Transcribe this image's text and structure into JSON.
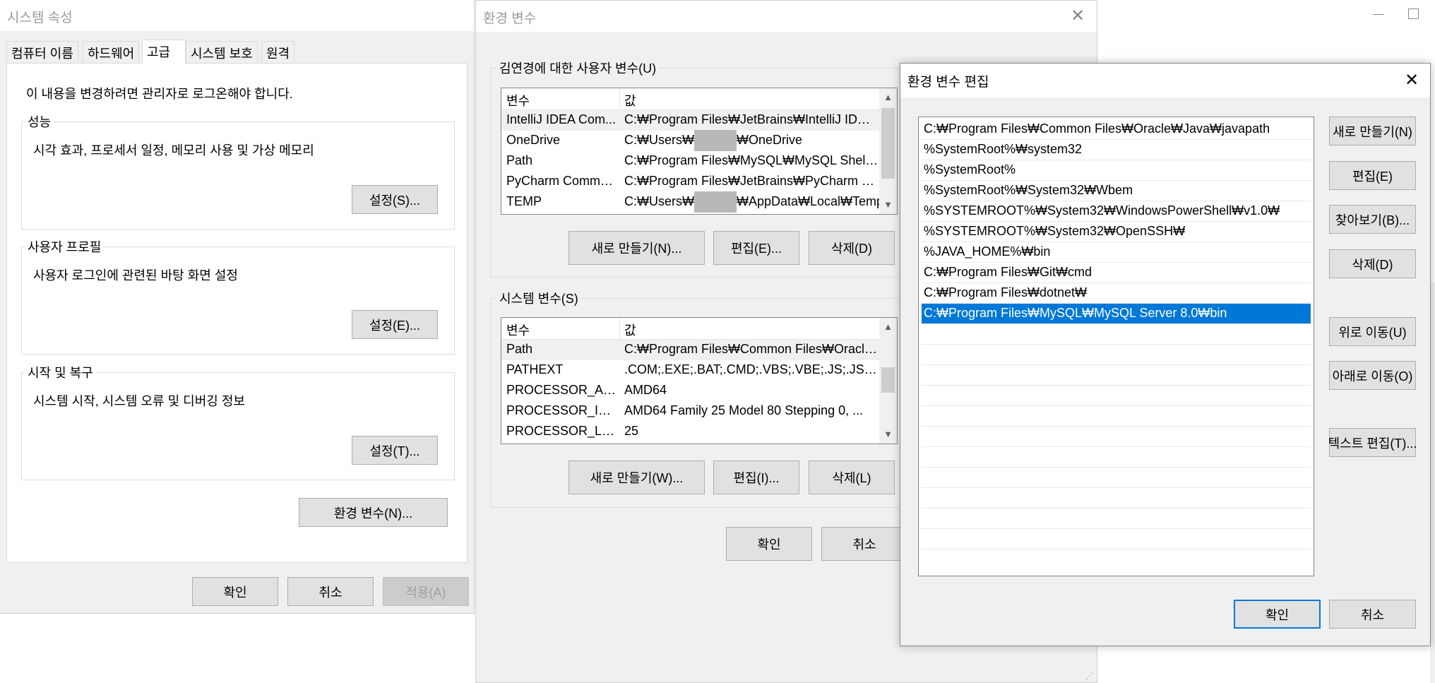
{
  "sys_props": {
    "title": "시스템 속성",
    "tabs": [
      "컴퓨터 이름",
      "하드웨어",
      "고급",
      "시스템 보호",
      "원격"
    ],
    "admin_note": "이 내용을 변경하려면 관리자로 로그온해야 합니다.",
    "perf": {
      "label": "성능",
      "desc": "시각 효과, 프로세서 일정, 메모리 사용 및 가상 메모리",
      "button": "설정(S)..."
    },
    "profile": {
      "label": "사용자 프로필",
      "desc": "사용자 로그인에 관련된 바탕 화면 설정",
      "button": "설정(E)..."
    },
    "startup": {
      "label": "시작 및 복구",
      "desc": "시스템 시작, 시스템 오류 및 디버깅 정보",
      "button": "설정(T)..."
    },
    "env_button": "환경 변수(N)...",
    "ok": "확인",
    "cancel": "취소",
    "apply": "적용(A)"
  },
  "env_vars": {
    "title": "환경 변수",
    "user_group_label": "김연경에 대한 사용자 변수(U)",
    "col_var": "변수",
    "col_val": "값",
    "user_rows": [
      {
        "name": "IntelliJ IDEA Com...",
        "value": "C:₩Program Files₩JetBrains₩IntelliJ IDEA ..."
      },
      {
        "name": "OneDrive",
        "value_pre": "C:₩Users₩",
        "value_post": "₩OneDrive"
      },
      {
        "name": "Path",
        "value": "C:₩Program Files₩MySQL₩MySQL Shell ..."
      },
      {
        "name": "PyCharm Commu...",
        "value": "C:₩Program Files₩JetBrains₩PyCharm Co..."
      },
      {
        "name": "TEMP",
        "value_pre": "C:₩Users₩",
        "value_post": "₩AppData₩Local₩Temp"
      }
    ],
    "user_new": "새로 만들기(N)...",
    "user_edit": "편집(E)...",
    "user_delete": "삭제(D)",
    "sys_group_label": "시스템 변수(S)",
    "sys_rows": [
      {
        "name": "Path",
        "value": "C:₩Program Files₩Common Files₩Oracle..."
      },
      {
        "name": "PATHEXT",
        "value": ".COM;.EXE;.BAT;.CMD;.VBS;.VBE;.JS;.JSE;.W..."
      },
      {
        "name": "PROCESSOR_ARC...",
        "value": "AMD64"
      },
      {
        "name": "PROCESSOR_IDE...",
        "value": "AMD64 Family 25 Model 80 Stepping 0, ..."
      },
      {
        "name": "PROCESSOR_LEVEL",
        "value": "25"
      }
    ],
    "sys_new": "새로 만들기(W)...",
    "sys_edit": "편집(I)...",
    "sys_delete": "삭제(L)",
    "ok": "확인",
    "cancel": "취소"
  },
  "edit_env": {
    "title": "환경 변수 편집",
    "paths": [
      "C:₩Program Files₩Common Files₩Oracle₩Java₩javapath",
      "%SystemRoot%₩system32",
      "%SystemRoot%",
      "%SystemRoot%₩System32₩Wbem",
      "%SYSTEMROOT%₩System32₩WindowsPowerShell₩v1.0₩",
      "%SYSTEMROOT%₩System32₩OpenSSH₩",
      "%JAVA_HOME%₩bin",
      "C:₩Program Files₩Git₩cmd",
      "C:₩Program Files₩dotnet₩",
      "C:₩Program Files₩MySQL₩MySQL Server 8.0₩bin"
    ],
    "selected_index": 9,
    "new": "새로 만들기(N)",
    "edit": "편집(E)",
    "browse": "찾아보기(B)...",
    "delete": "삭제(D)",
    "move_up": "위로 이동(U)",
    "move_down": "아래로 이동(O)",
    "edit_text": "텍스트 편집(T)...",
    "ok": "확인",
    "cancel": "취소"
  }
}
